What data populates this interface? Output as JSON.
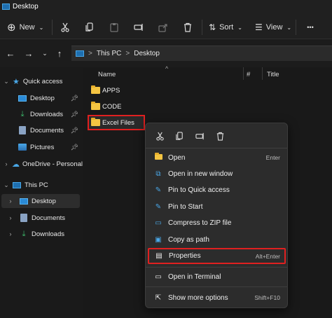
{
  "window": {
    "title": "Desktop"
  },
  "toolbar": {
    "new_label": "New",
    "sort_label": "Sort",
    "view_label": "View",
    "more_label": "•••"
  },
  "address": {
    "crumbs": [
      "This PC",
      "Desktop"
    ],
    "separator": ">"
  },
  "columns": {
    "name": "Name",
    "hash": "#",
    "title": "Title"
  },
  "sidebar": {
    "quick_access": {
      "label": "Quick access",
      "items": [
        {
          "label": "Desktop",
          "icon": "desktop-icon",
          "pinned": true
        },
        {
          "label": "Downloads",
          "icon": "downloads-icon",
          "pinned": true
        },
        {
          "label": "Documents",
          "icon": "documents-icon",
          "pinned": true
        },
        {
          "label": "Pictures",
          "icon": "pictures-icon",
          "pinned": true
        }
      ]
    },
    "onedrive": {
      "label": "OneDrive - Personal"
    },
    "this_pc": {
      "label": "This PC",
      "items": [
        {
          "label": "Desktop",
          "selected": true
        },
        {
          "label": "Documents"
        },
        {
          "label": "Downloads"
        }
      ]
    }
  },
  "files": [
    {
      "name": "APPS"
    },
    {
      "name": "CODE"
    },
    {
      "name": "Excel Files",
      "highlighted": true
    }
  ],
  "context_menu": {
    "items": [
      {
        "label": "Open",
        "shortcut": "Enter",
        "icon": "folder-icon"
      },
      {
        "label": "Open in new window",
        "shortcut": "",
        "icon": "new-window-icon"
      },
      {
        "label": "Pin to Quick access",
        "shortcut": "",
        "icon": "pin-icon"
      },
      {
        "label": "Pin to Start",
        "shortcut": "",
        "icon": "pin-icon"
      },
      {
        "label": "Compress to ZIP file",
        "shortcut": "",
        "icon": "zip-icon"
      },
      {
        "label": "Copy as path",
        "shortcut": "",
        "icon": "copy-path-icon"
      },
      {
        "label": "Properties",
        "shortcut": "Alt+Enter",
        "icon": "properties-icon",
        "highlighted": true
      },
      {
        "label": "Open in Terminal",
        "shortcut": "",
        "icon": "terminal-icon"
      },
      {
        "label": "Show more options",
        "shortcut": "Shift+F10",
        "icon": "more-options-icon"
      }
    ]
  },
  "colors": {
    "accent": "#4aa8e8",
    "folder": "#f5c542",
    "highlight": "#e02020",
    "background": "#191919"
  }
}
